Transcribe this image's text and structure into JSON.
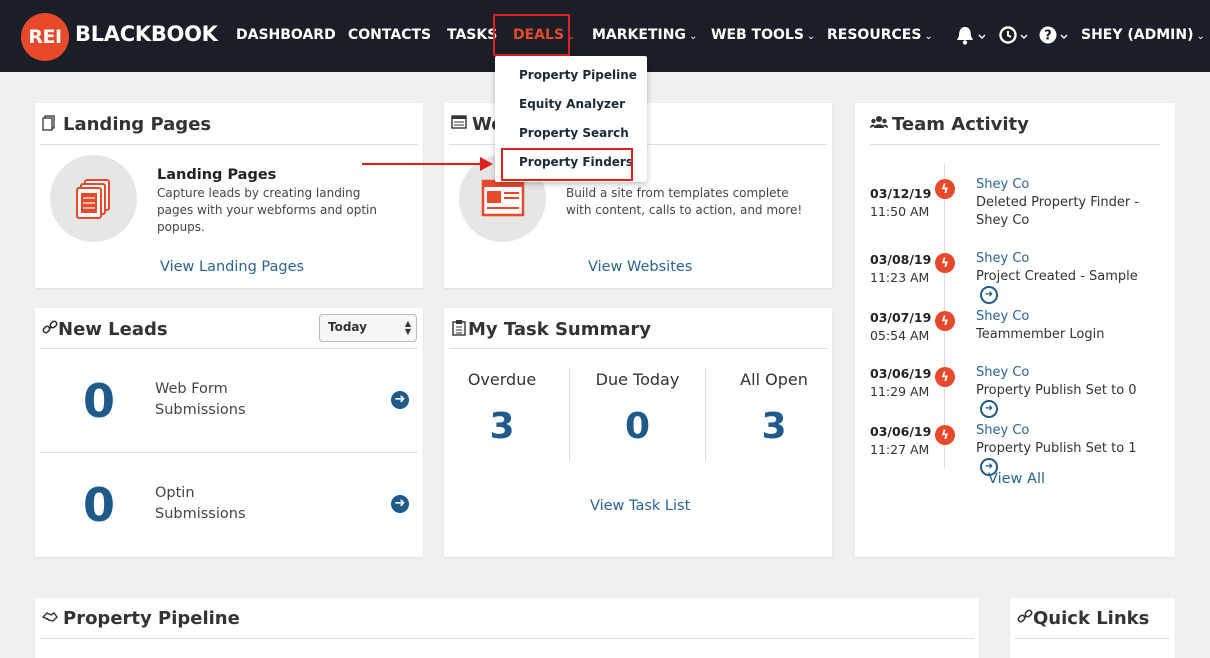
{
  "brand": {
    "badge": "REI",
    "name": "BLACKBOOK"
  },
  "nav": {
    "dashboard": "DASHBOARD",
    "contacts": "CONTACTS",
    "tasks": "TASKS",
    "deals": "DEALS",
    "marketing": "MARKETING",
    "web_tools": "WEB TOOLS",
    "resources": "RESOURCES",
    "user": "SHEY (ADMIN)",
    "chevron": "⌄"
  },
  "deals_menu": {
    "items": [
      "Property Pipeline",
      "Equity Analyzer",
      "Property Search",
      "Property Finders"
    ]
  },
  "landing": {
    "title": "Landing Pages",
    "heading": "Landing Pages",
    "desc": "Capture leads by creating landing pages with your webforms and optin popups.",
    "link": "View Landing Pages"
  },
  "websites": {
    "title": "We",
    "desc": "Build a site from templates complete with content, calls to action, and more!",
    "link": "View Websites"
  },
  "leads": {
    "title": "New Leads",
    "filter": "Today",
    "rows": [
      {
        "count": "0",
        "label_1": "Web Form",
        "label_2": "Submissions"
      },
      {
        "count": "0",
        "label_1": "Optin",
        "label_2": "Submissions"
      }
    ]
  },
  "tasks": {
    "title": "My Task Summary",
    "cols": [
      {
        "label": "Overdue",
        "value": "3"
      },
      {
        "label": "Due Today",
        "value": "0"
      },
      {
        "label": "All Open",
        "value": "3"
      }
    ],
    "link": "View Task List"
  },
  "activity": {
    "title": "Team Activity",
    "items": [
      {
        "date": "03/12/19",
        "time": "11:50 AM",
        "name": "Shey Co",
        "desc": "Deleted Property Finder - Shey Co"
      },
      {
        "date": "03/08/19",
        "time": "11:23 AM",
        "name": "Shey Co",
        "desc": "Project Created - Sample"
      },
      {
        "date": "03/07/19",
        "time": "05:54 AM",
        "name": "Shey Co",
        "desc": "Teammember Login"
      },
      {
        "date": "03/06/19",
        "time": "11:29 AM",
        "name": "Shey Co",
        "desc": "Property Publish Set to 0"
      },
      {
        "date": "03/06/19",
        "time": "11:27 AM",
        "name": "Shey Co",
        "desc": "Property Publish Set to 1"
      }
    ],
    "link": "View All"
  },
  "pipeline": {
    "title": "Property Pipeline"
  },
  "quick_links": {
    "title": "Quick Links"
  },
  "colors": {
    "navbar": "#1a1e26",
    "accent": "#e8492b",
    "link": "#2a6496",
    "number": "#1e5a8a",
    "highlight": "#e02020"
  }
}
